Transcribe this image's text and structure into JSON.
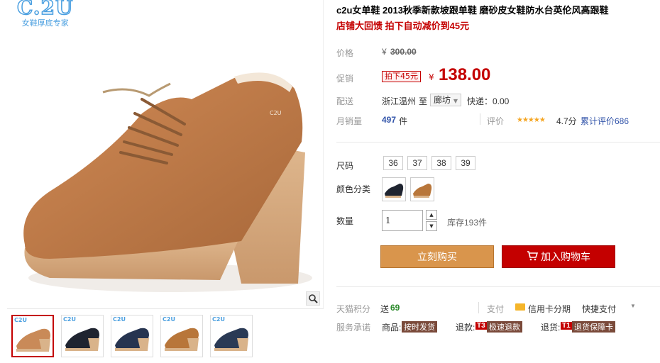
{
  "logo": {
    "brand": "C.2U",
    "tagline": "女鞋厚底专家"
  },
  "thumbnails": [
    {
      "tag": "C2U",
      "color": "#c98a58",
      "active": true
    },
    {
      "tag": "C2U",
      "color": "#1f2430"
    },
    {
      "tag": "C2U",
      "color": "#263450"
    },
    {
      "tag": "C2U",
      "color": "#b8763a"
    },
    {
      "tag": "C2U",
      "color": "#2a3a55"
    }
  ],
  "product": {
    "title": "c2u女单鞋 2013秋季新款坡跟单鞋 磨砂皮女鞋防水台英伦风高跟鞋",
    "promo": "店铺大回馈 拍下自动减价到45元"
  },
  "price": {
    "label": "价格",
    "currency": "¥",
    "original": "300.00",
    "promo_label": "促销",
    "promo_tag": "拍下45元",
    "current": "138.00"
  },
  "delivery": {
    "label": "配送",
    "from": "浙江温州",
    "to_word": "至",
    "destination": "廊坊",
    "express": "快递：0.00"
  },
  "sales": {
    "label": "月销量",
    "count": "497",
    "unit": "件",
    "review_label": "评价",
    "stars": "★★★★★",
    "rating": "4.7分",
    "review_total": "累计评价686"
  },
  "size": {
    "label": "尺码",
    "options": [
      "36",
      "37",
      "38",
      "39"
    ]
  },
  "color": {
    "label": "颜色分类",
    "options": [
      {
        "swatch": "#1f2430"
      },
      {
        "swatch": "#b8763a"
      }
    ]
  },
  "quantity": {
    "label": "数量",
    "value": "1",
    "stock": "库存193件",
    "up": "▲",
    "down": "▼"
  },
  "actions": {
    "buy": "立刻购买",
    "cart": "加入购物车"
  },
  "points": {
    "label": "天猫积分",
    "value_prefix": "送",
    "value": "69",
    "pay_label": "支付",
    "credit": "信用卡分期",
    "quick": "快捷支付"
  },
  "service": {
    "label": "服务承诺",
    "goods": "商品:",
    "goods_badge": "按时发货",
    "refund": "退款:",
    "refund_num": "T3",
    "refund_badge": "极速退款",
    "return": "退货:",
    "return_num": "T1",
    "return_badge": "退货保障卡"
  }
}
